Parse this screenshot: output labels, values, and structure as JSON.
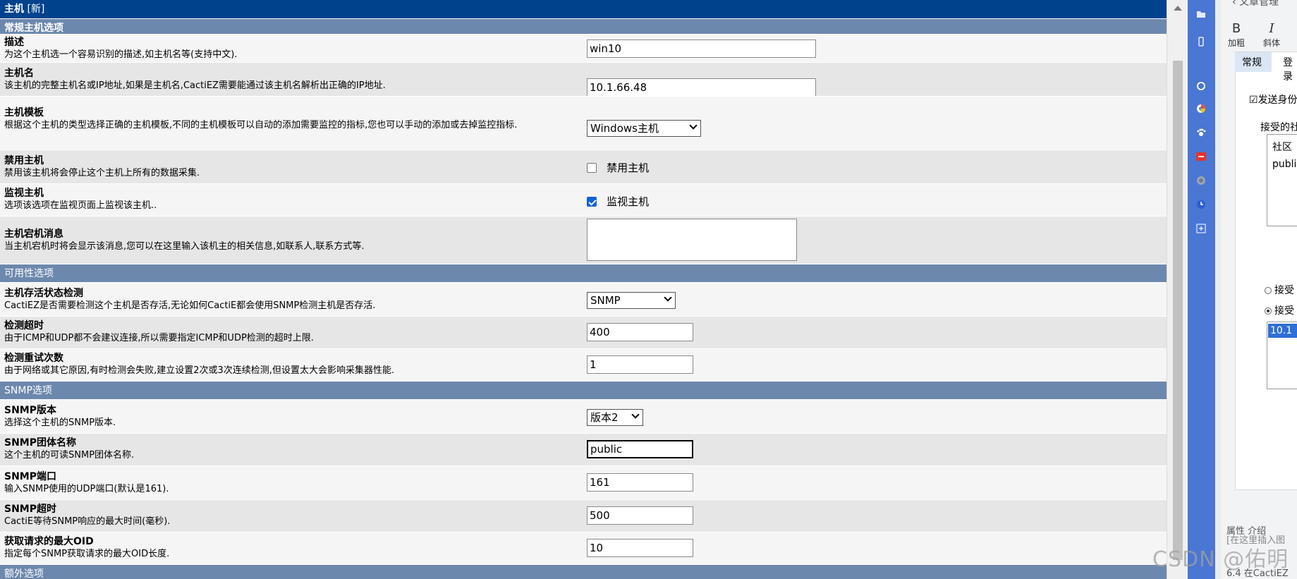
{
  "header": {
    "title": "主机",
    "badge": "[新]"
  },
  "sections": {
    "general": "常规主机选项",
    "availability": "可用性选项",
    "snmp": "SNMP选项",
    "extra": "额外选项"
  },
  "fields": {
    "description": {
      "label": "描述",
      "help": "为这个主机选一个容易识别的描述,如主机名等(支持中文).",
      "value": "win10"
    },
    "hostname": {
      "label": "主机名",
      "help": "该主机的完整主机名或IP地址,如果是主机名,CactiEZ需要能通过该主机名解析出正确的IP地址.",
      "value": "10.1.66.48"
    },
    "template": {
      "label": "主机模板",
      "help": "根据这个主机的类型选择正确的主机模板,不同的主机模板可以自动的添加需要监控的指标,您也可以手动的添加或去掉监控指标.",
      "value": "Windows主机"
    },
    "disable": {
      "label": "禁用主机",
      "help": "禁用该主机将会停止这个主机上所有的数据采集.",
      "checkbox_label": "禁用主机",
      "checked": false
    },
    "monitor": {
      "label": "监视主机",
      "help": "选项该选项在监视页面上监视该主机..",
      "checkbox_label": "监视主机",
      "checked": true
    },
    "down_msg": {
      "label": "主机宕机消息",
      "help": "当主机宕机时将会显示该消息,您可以在这里输入该机主的相关信息,如联系人,联系方式等.",
      "value": ""
    },
    "availability_method": {
      "label": "主机存活状态检测",
      "help": "CactiEZ是否需要检测这个主机是否存活,无论如何CactiE都会使用SNMP检测主机是否存活.",
      "value": "SNMP"
    },
    "ping_timeout": {
      "label": "检测超时",
      "help": "由于ICMP和UDP都不会建议连接,所以需要指定ICMP和UDP检测的超时上限.",
      "value": "400"
    },
    "ping_retries": {
      "label": "检测重试次数",
      "help": "由于网络或其它原因,有时检测会失败,建立设置2次或3次连续检测,但设置太大会影响采集器性能.",
      "value": "1"
    },
    "snmp_version": {
      "label": "SNMP版本",
      "help": "选择这个主机的SNMP版本.",
      "value": "版本2"
    },
    "snmp_community": {
      "label": "SNMP团体名称",
      "help": "这个主机的可读SNMP团体名称.",
      "value": "public"
    },
    "snmp_port": {
      "label": "SNMP端口",
      "help": "输入SNMP使用的UDP端口(默认是161).",
      "value": "161"
    },
    "snmp_timeout": {
      "label": "SNMP超时",
      "help": "CactiE等待SNMP响应的最大时间(毫秒).",
      "value": "500"
    },
    "max_oids": {
      "label": "获取请求的最大OID",
      "help": "指定每个SNMP获取请求的最大OID长度.",
      "value": "10"
    }
  },
  "right_panel": {
    "title": "文章管理",
    "bold_glyph": "B",
    "bold_label": "加粗",
    "italic_glyph": "I",
    "italic_label": "斜体",
    "tab_general": "常规",
    "tab_other": "登录",
    "send_auth": "发送身份",
    "accepted_group": "接受的社",
    "community_header": "社区",
    "community_item": "publi",
    "radio1": "接受",
    "radio2": "接受",
    "host_item": "10.1",
    "footer0": "属性  介绍",
    "footer1": "[在这里插入图",
    "footer2": "6.4 在CactiEZ"
  },
  "watermark": "CSDN @佑明",
  "colors": {
    "header": "#00438c",
    "section": "#6d88ad",
    "row_light": "#f5f5f5",
    "row_dark": "#e6e6e6",
    "app_strip": "#4a76d4"
  }
}
